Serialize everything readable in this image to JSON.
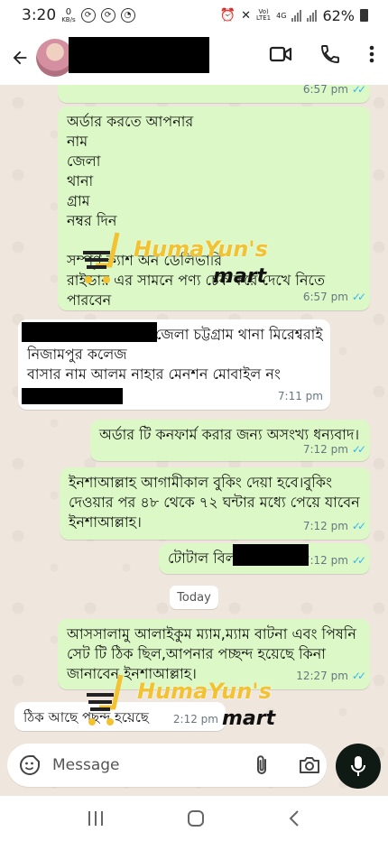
{
  "status_bar": {
    "time": "3:20",
    "data_speed_value": "0",
    "data_speed_unit": "KB/s",
    "network_top": "Vo)",
    "network_bottom": "LTE1",
    "network_type": "4G",
    "battery": "62%"
  },
  "header": {
    "contact_name": "",
    "icons": [
      "back-arrow-icon",
      "video-call-icon",
      "phone-icon",
      "more-vert-icon"
    ]
  },
  "messages": [
    {
      "direction": "outgoing",
      "lines": [],
      "time": "6:57 pm",
      "read": true
    },
    {
      "direction": "outgoing",
      "lines": [
        "অর্ডার করতে আপনার",
        "নাম",
        "জেলা",
        "থানা",
        "গ্রাম",
        "নম্বর দিন",
        "",
        "সম্পূর্ণ ক্যাশ অন ডেলিভারি",
        "রাইডার এর সামনে পণ্য চেক করে দেখে নিতে",
        "পারবেন"
      ],
      "time": "6:57 pm",
      "read": true
    },
    {
      "direction": "incoming",
      "lines": [
        "জেলা চট্টগ্রাম থানা মিরেশ্বরাই",
        "নিজামপুর কলেজ",
        "বাসার নাম আলম নাহার মেনশন মোবাইল নং"
      ],
      "time": "7:11 pm"
    },
    {
      "direction": "outgoing",
      "lines": [
        "অর্ডার টি কনফার্ম করার জন্য অসংখ্য ধন্যবাদ।"
      ],
      "time": "7:12 pm",
      "read": true
    },
    {
      "direction": "outgoing",
      "lines": [
        "ইনশাআল্লাহ আগামীকাল বুকিং দেয়া হবে।বুকিং",
        "দেওয়ার পর ৪৮ থেকে ৭২ ঘন্টার মধ্যে পেয়ে যাবেন",
        "ইনশাআল্লাহ।"
      ],
      "time": "7:12 pm",
      "read": true
    },
    {
      "direction": "outgoing",
      "lines": [
        "টোটাল বিল"
      ],
      "time": "7:12 pm",
      "read": true
    },
    {
      "direction": "outgoing",
      "lines": [
        "আসসালামু আলাইকুম ম্যাম,ম্যাম বাটনা এবং পিষনি",
        "সেট টি ঠিক ছিল,আপনার পচ্ছন্দ হয়েছে কিনা",
        "জানাবেন ইনশাআল্লাহ।"
      ],
      "time": "12:27 pm",
      "read": true
    },
    {
      "direction": "incoming",
      "lines": [
        "ঠিক আছে পছন্দ হয়েছে"
      ],
      "time": "2:12 pm"
    }
  ],
  "day_separator": "Today",
  "watermark": {
    "line1": "HumaYun's",
    "line2": "mart"
  },
  "input": {
    "placeholder": "Message"
  },
  "colors": {
    "outgoing_bubble": "#dbf8c6",
    "incoming_bubble": "#ffffff",
    "chat_bg": "#efe7de",
    "read_ticks": "#34b7f1",
    "mic_button": "#0f1a14"
  },
  "nav_bar": {
    "icons": [
      "recent-apps-icon",
      "home-icon",
      "back-nav-icon"
    ]
  }
}
